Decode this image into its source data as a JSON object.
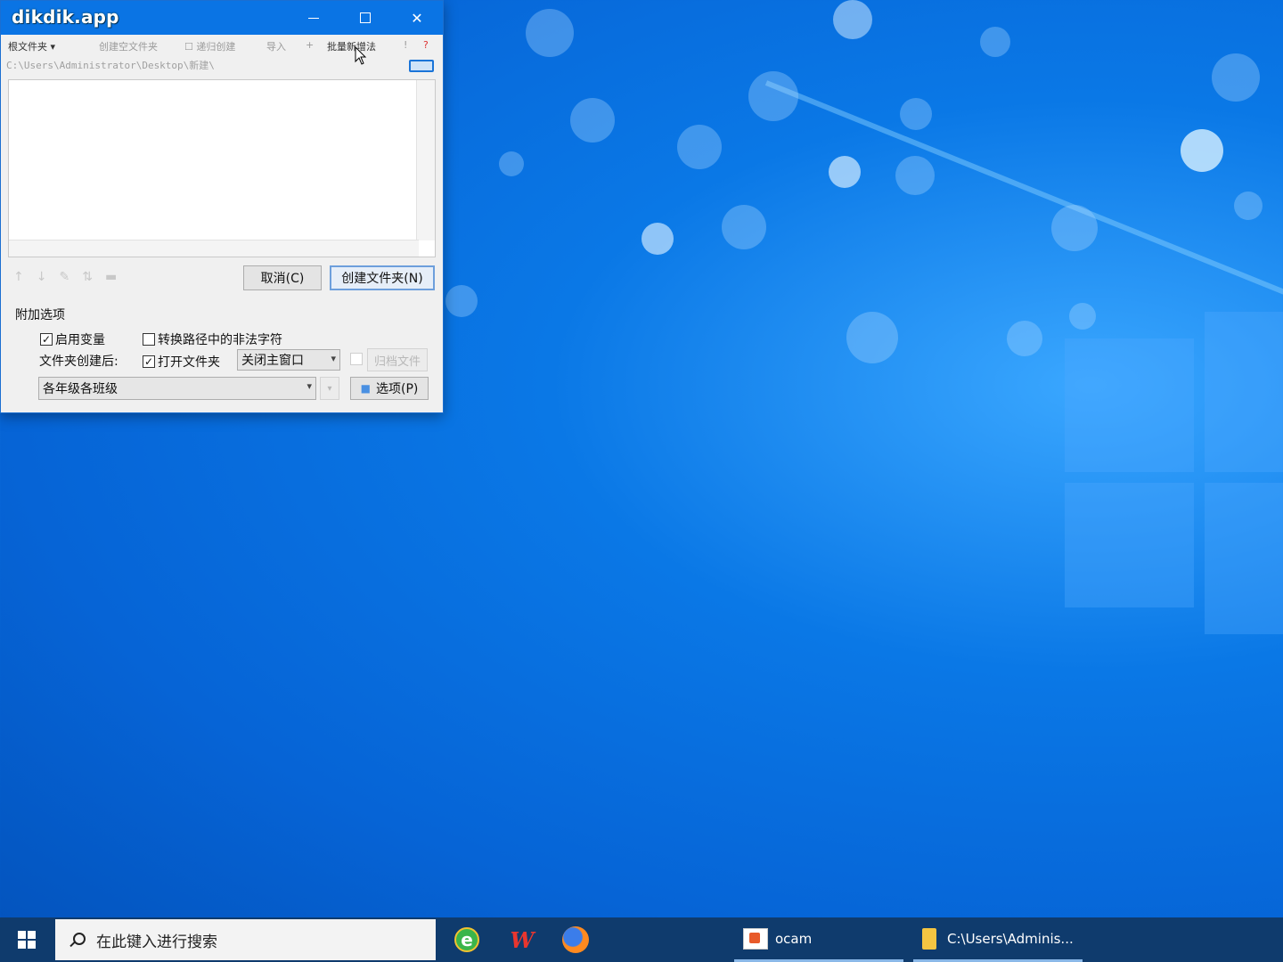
{
  "window": {
    "title": "dikdik.app",
    "toolbar": {
      "root_folder": "根文件夹 ▾",
      "new_subfolder": "创建空文件夹",
      "checkbox_item": "递归创建",
      "import": "导入",
      "plus": "+",
      "batch_create": "批量新增法",
      "info": "!",
      "help": "?"
    },
    "path": "C:\\Users\\Administrator\\Desktop\\新建\\",
    "buttons": {
      "cancel": "取消(C)",
      "create_folder": "创建文件夹(N)",
      "options": "选项(P)",
      "archive_file": "归档文件"
    },
    "extra_options": {
      "section_title": "附加选项",
      "enable_variables": "启用变量",
      "enable_variables_checked": true,
      "convert_illegal_chars": "转换路径中的非法字符",
      "convert_illegal_chars_checked": false,
      "after_create_label": "文件夹创建后:",
      "open_folder": "打开文件夹",
      "open_folder_checked": true,
      "after_action_select": "关闭主窗口",
      "template_select": "各年级各班级"
    }
  },
  "taskbar": {
    "search_placeholder": "在此键入进行搜索",
    "running_apps": [
      {
        "label": "ocam"
      },
      {
        "label": "C:\\Users\\Adminis..."
      }
    ]
  },
  "colors": {
    "titlebar": "#0a74e4",
    "taskbar": "#0f3b6d",
    "desktop": "#0a78e6"
  }
}
